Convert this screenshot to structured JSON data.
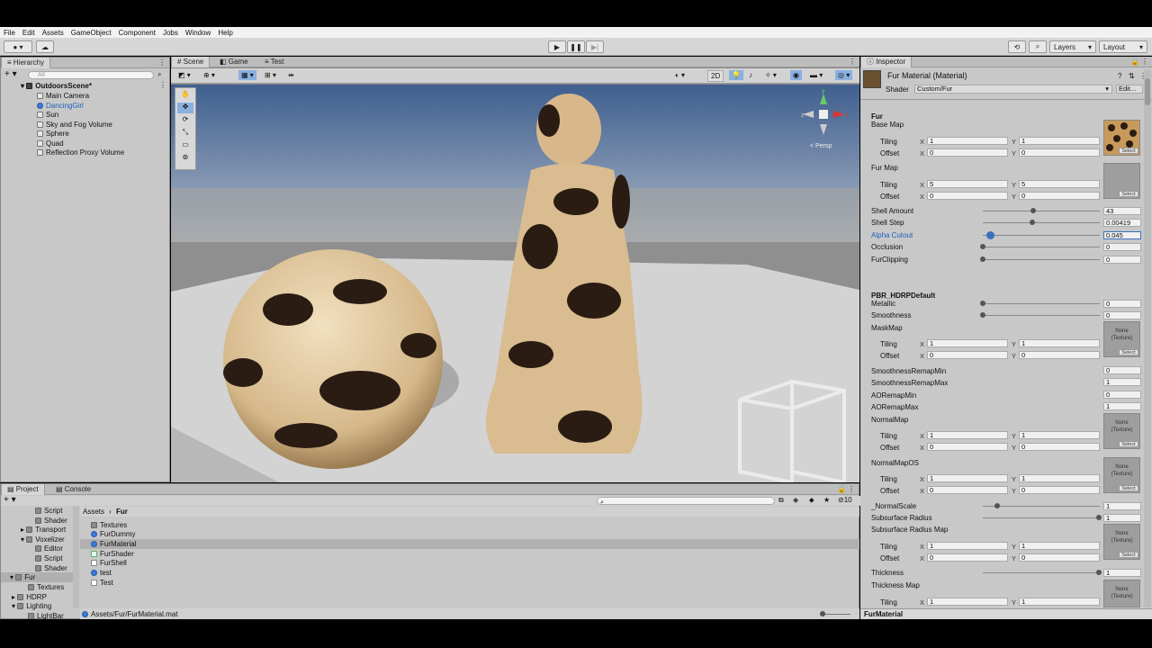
{
  "menu": [
    "File",
    "Edit",
    "Assets",
    "GameObject",
    "Component",
    "Jobs",
    "Window",
    "Help"
  ],
  "toolbar": {
    "layers": "Layers",
    "layout": "Layout"
  },
  "hierarchy": {
    "tab": "Hierarchy",
    "search_placeholder": "All",
    "scene": "OutdoorsScene*",
    "items": [
      "Main Camera",
      "DancingGirl",
      "Sun",
      "Sky and Fog Volume",
      "Sphere",
      "Quad",
      "Reflection Proxy Volume"
    ]
  },
  "scene_view": {
    "tabs": [
      "Scene",
      "Game",
      "Test"
    ],
    "mode_2d": "2D",
    "persp": "< Persp",
    "gizmo_axes": {
      "x": "x",
      "y": "y",
      "z": "z"
    }
  },
  "project": {
    "tabs": [
      "Project",
      "Console"
    ],
    "tree": [
      "Script",
      "Shader",
      "Transport",
      "Voxelizer",
      "Editor",
      "Script",
      "Shader",
      "Fur",
      "Textures",
      "HDRP",
      "Lighting",
      "LightBar"
    ],
    "breadcrumb": [
      "Assets",
      "Fur"
    ],
    "assets": [
      "Textures",
      "FurDummy",
      "FurMaterial",
      "FurShader",
      "FurShell",
      "test",
      "Test"
    ],
    "path": "Assets/Fur/FurMaterial.mat",
    "count": "10"
  },
  "inspector": {
    "tab": "Inspector",
    "title": "Fur Material (Material)",
    "shader_label": "Shader",
    "shader_value": "Custom/Fur",
    "edit": "Edit...",
    "section_fur": "Fur",
    "base_map": "Base Map",
    "fur_map": "Fur Map",
    "tiling": "Tiling",
    "offset": "Offset",
    "x": "X",
    "y": "Y",
    "select": "Select",
    "none_texture": "None (Texture)",
    "base_tiling": [
      "1",
      "1"
    ],
    "base_offset": [
      "0",
      "0"
    ],
    "fur_tiling": [
      "5",
      "5"
    ],
    "fur_offset": [
      "0",
      "0"
    ],
    "sliders": [
      {
        "label": "Shell Amount",
        "value": "43",
        "pos": 0.43
      },
      {
        "label": "Shell Step",
        "value": "0.00419",
        "pos": 0.42
      },
      {
        "label": "Alpha Cutout",
        "value": "0.045",
        "pos": 0.05
      },
      {
        "label": "Occlusion",
        "value": "0",
        "pos": 0.0
      },
      {
        "label": "FurClipping",
        "value": "0",
        "pos": 0.0
      }
    ],
    "section_pbr": "PBR_HDRPDefault",
    "metallic": {
      "label": "Metallic",
      "value": "0"
    },
    "smoothness": {
      "label": "Smoothness",
      "value": "0"
    },
    "maskmap": "MaskMap",
    "mask_tiling": [
      "1",
      "1"
    ],
    "mask_offset": [
      "0",
      "0"
    ],
    "remaps": [
      {
        "label": "SmoothnessRemapMin",
        "value": "0"
      },
      {
        "label": "SmoothnessRemapMax",
        "value": "1"
      },
      {
        "label": "AORemapMin",
        "value": "0"
      },
      {
        "label": "AORemapMax",
        "value": "1"
      }
    ],
    "normalmap": "NormalMap",
    "normal_tiling": [
      "1",
      "1"
    ],
    "normal_offset": [
      "0",
      "0"
    ],
    "normalmapos": "NormalMapOS",
    "normalos_tiling": [
      "1",
      "1"
    ],
    "normalos_offset": [
      "0",
      "0"
    ],
    "normalscale": {
      "label": "_NormalScale",
      "value": "1"
    },
    "subsurface_radius": {
      "label": "Subsurface Radius",
      "value": "1"
    },
    "subsurface_radius_map": "Subsurface Radius Map",
    "ssr_tiling": [
      "1",
      "1"
    ],
    "ssr_offset": [
      "0",
      "0"
    ],
    "thickness": {
      "label": "Thickness",
      "value": "1"
    },
    "thickness_map": "Thickness Map",
    "tm_tiling": [
      "1",
      "1"
    ],
    "footer": "FurMaterial"
  }
}
